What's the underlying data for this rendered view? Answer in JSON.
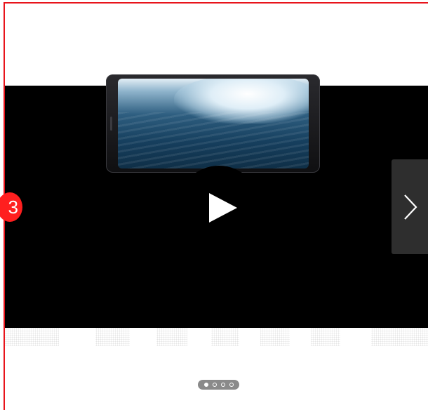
{
  "annotation": {
    "step_number": "3",
    "outline_color": "#e8141b",
    "badge_color": "#ff1f1f"
  },
  "video": {
    "play_icon": "play-icon",
    "thumbnail": "phone-with-surfing-wave"
  },
  "carousel": {
    "next_icon": "chevron-right-icon",
    "pages": [
      {
        "active": true
      },
      {
        "active": false
      },
      {
        "active": false
      },
      {
        "active": false
      }
    ]
  }
}
